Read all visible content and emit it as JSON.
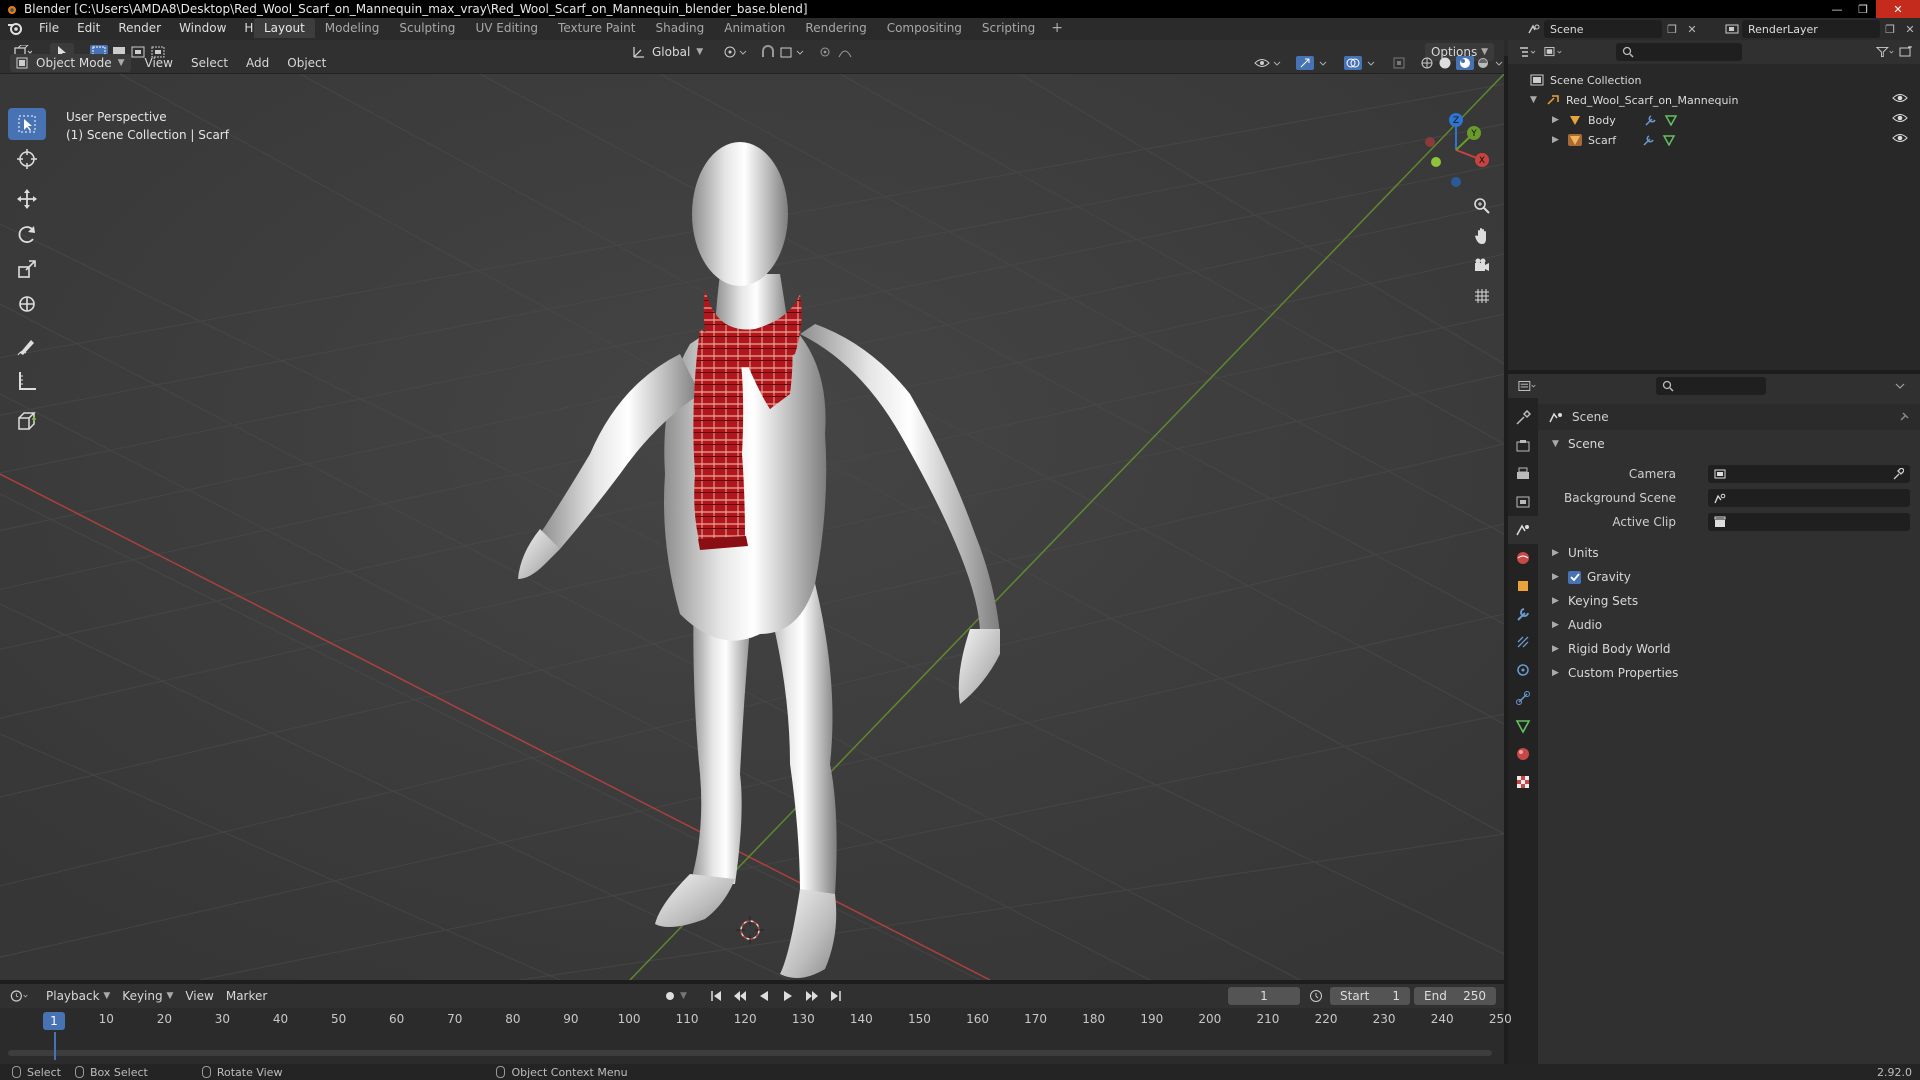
{
  "window": {
    "title": "Blender [C:\\Users\\AMDA8\\Desktop\\Red_Wool_Scarf_on_Mannequin_max_vray\\Red_Wool_Scarf_on_Mannequin_blender_base.blend]",
    "minimize": "—",
    "maximize": "❐",
    "close": "✕"
  },
  "menu": [
    "File",
    "Edit",
    "Render",
    "Window",
    "Help"
  ],
  "workspaces": [
    "Layout",
    "Modeling",
    "Sculpting",
    "UV Editing",
    "Texture Paint",
    "Shading",
    "Animation",
    "Rendering",
    "Compositing",
    "Scripting"
  ],
  "workspace_add": "+",
  "scene_selector": {
    "value": "Scene"
  },
  "layer_selector": {
    "value": "RenderLayer"
  },
  "viewport_header": {
    "mode": "Object Mode",
    "menus": [
      "View",
      "Select",
      "Add",
      "Object"
    ],
    "orientation": "Global",
    "options": "Options"
  },
  "viewport_info": {
    "line1": "User Perspective",
    "line2": "(1) Scene Collection | Scarf"
  },
  "gizmo": {
    "x": "X",
    "y": "Y",
    "z": "Z"
  },
  "outliner": {
    "root": "Scene Collection",
    "collection": "Red_Wool_Scarf_on_Mannequin",
    "objects": [
      "Body",
      "Scarf"
    ]
  },
  "properties": {
    "context": "Scene",
    "panel": "Scene",
    "fields": [
      {
        "label": "Camera",
        "value": ""
      },
      {
        "label": "Background Scene",
        "value": ""
      },
      {
        "label": "Active Clip",
        "value": ""
      }
    ],
    "subpanels": [
      "Units",
      "Gravity",
      "Keying Sets",
      "Audio",
      "Rigid Body World",
      "Custom Properties"
    ],
    "gravity_checked": true
  },
  "timeline": {
    "menus": [
      "Playback",
      "Keying",
      "View",
      "Marker"
    ],
    "current_frame": "1",
    "start_label": "Start",
    "start": "1",
    "end_label": "End",
    "end": "250",
    "ticks": [
      "10",
      "20",
      "30",
      "40",
      "50",
      "60",
      "70",
      "80",
      "90",
      "100",
      "110",
      "120",
      "130",
      "140",
      "150",
      "160",
      "170",
      "180",
      "190",
      "200",
      "210",
      "220",
      "230",
      "240",
      "250"
    ],
    "frame_marker": "1"
  },
  "statusbar": {
    "select": "Select",
    "box_select": "Box Select",
    "rotate": "Rotate View",
    "context_menu": "Object Context Menu",
    "version": "2.92.0"
  },
  "colors": {
    "accent": "#4772b3",
    "x_axis": "#c8423f",
    "y_axis": "#6a9a2a",
    "scarf_red": "#b3151c",
    "mannequin": "#c9c9c9"
  }
}
